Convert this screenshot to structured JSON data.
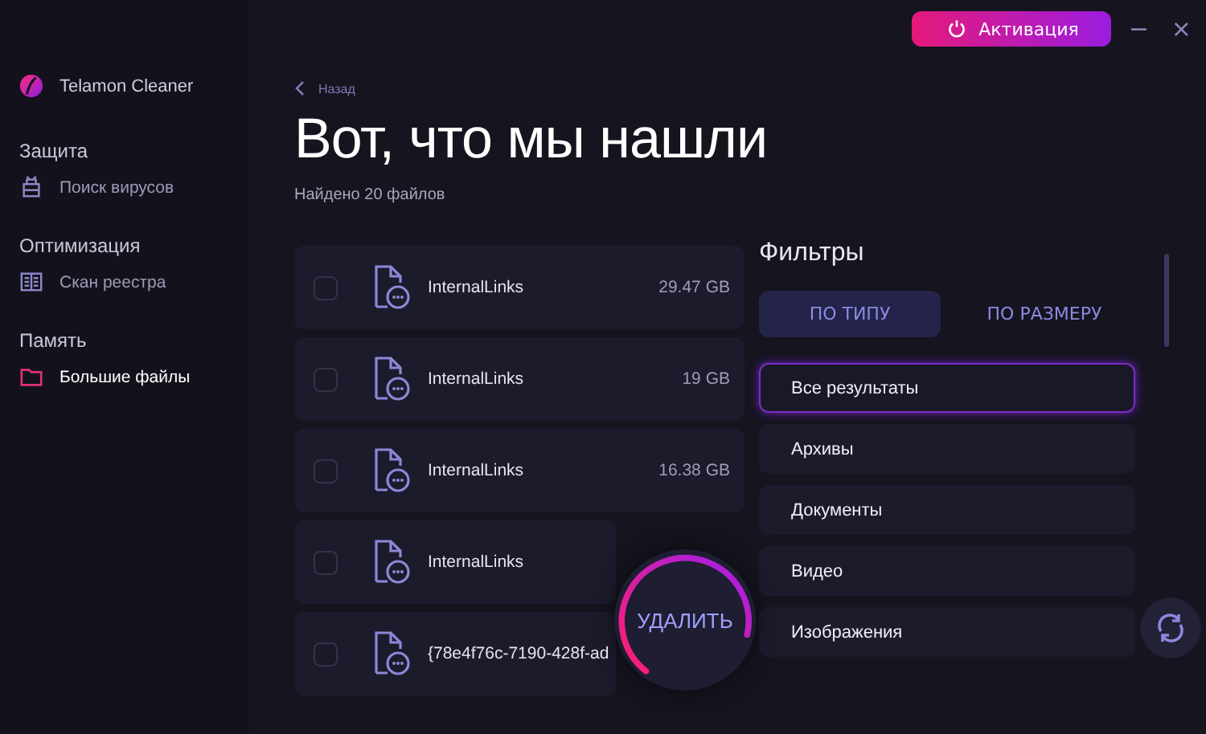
{
  "window": {
    "activate_button": "Активация",
    "minimize": "−",
    "close": "×"
  },
  "sidebar": {
    "app_name": "Telamon Cleaner",
    "sections": [
      {
        "title": "Защита",
        "items": [
          {
            "label": "Поиск вирусов",
            "kind": "virus",
            "selected": false
          }
        ]
      },
      {
        "title": "Оптимизация",
        "items": [
          {
            "label": "Скан реестра",
            "kind": "registry",
            "selected": false
          }
        ]
      },
      {
        "title": "Память",
        "items": [
          {
            "label": "Большие файлы",
            "kind": "folder",
            "selected": true
          }
        ]
      }
    ]
  },
  "main": {
    "back": "Назад",
    "title": "Вот, что мы нашли",
    "subtitle": "Найдено 20 файлов",
    "files": [
      {
        "name": "InternalLinks",
        "size": "29.47 GB",
        "checked": false
      },
      {
        "name": "InternalLinks",
        "size": "19 GB",
        "checked": false
      },
      {
        "name": "InternalLinks",
        "size": "16.38 GB",
        "checked": false
      },
      {
        "name": "InternalLinks",
        "checked": false
      },
      {
        "name": "{78e4f76c-7190-428f-ad",
        "checked": false
      }
    ],
    "delete_button": "УДАЛИТЬ"
  },
  "filters": {
    "title": "Фильтры",
    "tabs": [
      {
        "label": "ПО ТИПУ",
        "selected": true
      },
      {
        "label": "ПО РАЗМЕРУ",
        "selected": false
      }
    ],
    "items": [
      {
        "label": "Все результаты",
        "selected": true
      },
      {
        "label": "Архивы",
        "selected": false
      },
      {
        "label": "Документы",
        "selected": false
      },
      {
        "label": "Видео",
        "selected": false
      },
      {
        "label": "Изображения",
        "selected": false
      }
    ]
  }
}
